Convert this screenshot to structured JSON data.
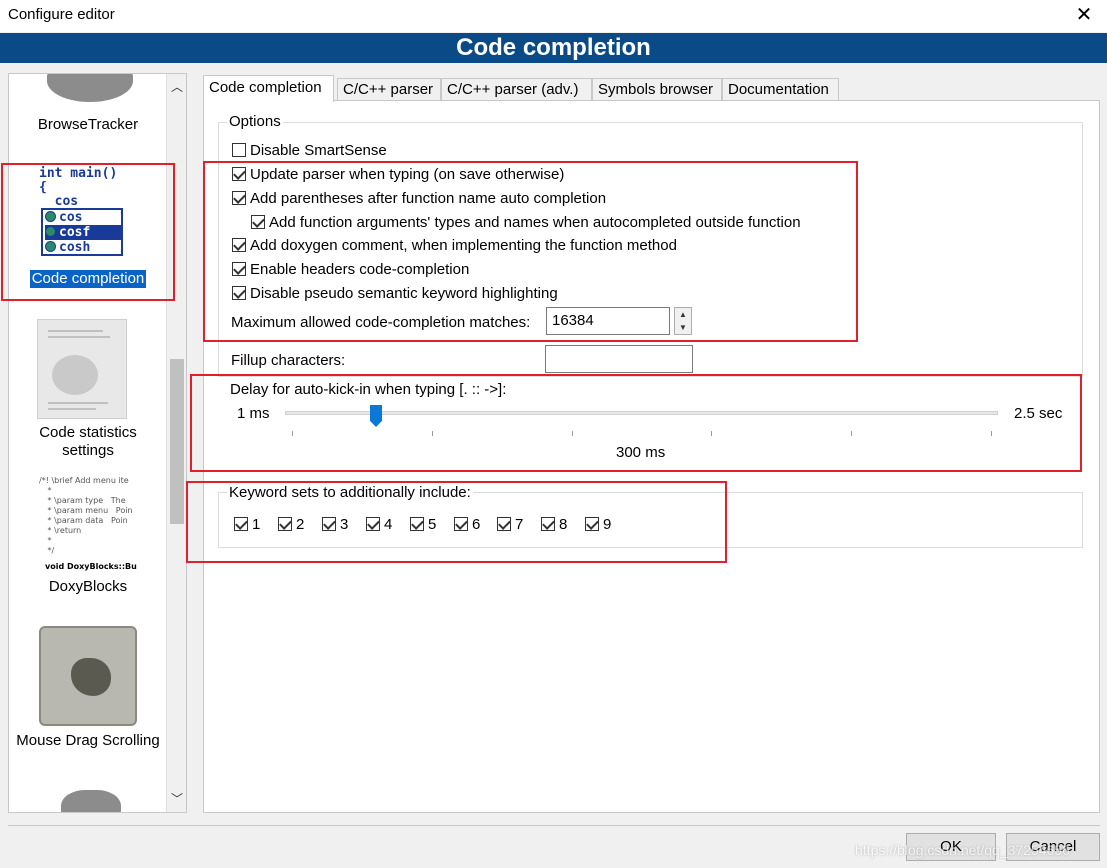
{
  "window": {
    "title": "Configure editor",
    "close_glyph": "✕"
  },
  "header": {
    "title": "Code completion"
  },
  "sidebar": {
    "items": [
      {
        "label": "BrowseTracker",
        "icon": "puzzle-icon"
      },
      {
        "label": "Code completion",
        "icon": "code-completion-icon",
        "selected": true
      },
      {
        "label": "Code statistics settings",
        "icon": "code-statistics-icon"
      },
      {
        "label": "DoxyBlocks",
        "icon": "doxyblocks-icon"
      },
      {
        "label": "Mouse Drag Scrolling",
        "icon": "mouse-drag-scrolling-icon"
      }
    ],
    "code_icon_lines": [
      "int main()",
      "{",
      "  cos"
    ],
    "code_icon_popup": [
      "cos",
      "cosf",
      "cosh"
    ],
    "doxy_icon_lines": [
      "/*! \\brief Add menu ite",
      " *",
      " * \\param type   The",
      " * \\param menu   Poin",
      " * \\param data   Poin",
      " * \\return",
      " *",
      " */",
      "void DoxyBlocks::Bu"
    ]
  },
  "tabs": [
    {
      "label": "Code completion",
      "active": true
    },
    {
      "label": "C/C++ parser"
    },
    {
      "label": "C/C++ parser (adv.)"
    },
    {
      "label": "Symbols browser"
    },
    {
      "label": "Documentation"
    }
  ],
  "options": {
    "group_label": "Options",
    "checkboxes": [
      {
        "label": "Disable SmartSense",
        "checked": false
      },
      {
        "label": "Update parser when typing (on save otherwise)",
        "checked": true
      },
      {
        "label": "Add parentheses after function name auto completion",
        "checked": true
      },
      {
        "label": "Add function arguments' types and names when autocompleted outside function",
        "checked": true
      },
      {
        "label": "Add doxygen comment, when implementing the function method",
        "checked": true
      },
      {
        "label": "Enable headers code-completion",
        "checked": true
      },
      {
        "label": "Disable pseudo semantic keyword highlighting",
        "checked": true
      }
    ],
    "max_matches_label": "Maximum allowed code-completion matches:",
    "max_matches_value": "16384",
    "fillup_label": "Fillup characters:",
    "fillup_value": ""
  },
  "delay": {
    "label": "Delay for auto-kick-in when typing [. :: ->]:",
    "min_label": "1 ms",
    "max_label": "2.5 sec",
    "value_label": "300 ms",
    "position": 0.13
  },
  "keywords": {
    "group_label": "Keyword sets to additionally include:",
    "sets": [
      {
        "label": "1",
        "checked": true
      },
      {
        "label": "2",
        "checked": true
      },
      {
        "label": "3",
        "checked": true
      },
      {
        "label": "4",
        "checked": true
      },
      {
        "label": "5",
        "checked": true
      },
      {
        "label": "6",
        "checked": true
      },
      {
        "label": "7",
        "checked": true
      },
      {
        "label": "8",
        "checked": true
      },
      {
        "label": "9",
        "checked": true
      }
    ]
  },
  "buttons": {
    "ok": "OK",
    "cancel": "Cancel"
  },
  "watermark": "https://blog.csdn.net/qq_37254656",
  "colors": {
    "header_bg": "#0a4a86",
    "highlight": "#e0202a",
    "selection": "#0a64c8"
  }
}
